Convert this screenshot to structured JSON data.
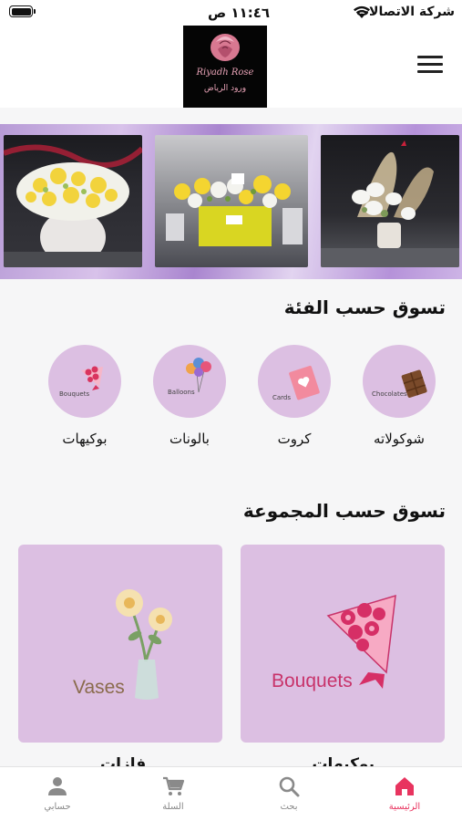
{
  "status_bar": {
    "time": "١١:٤٦ ص",
    "carrier": "شركة الاتصالات"
  },
  "header": {
    "logo_name": "Riyadh Rose",
    "logo_arabic": "ورود الرياض"
  },
  "banner": {
    "photos": [
      "yellow-white-bouquet",
      "yellow-roses-box",
      "white-orchids-vase"
    ]
  },
  "categories": {
    "title": "تسوق حسب الفئة",
    "items": [
      {
        "label": "شوكولاته",
        "icon_label": "Chocolates",
        "icon": "chocolate-icon"
      },
      {
        "label": "كروت",
        "icon_label": "Cards",
        "icon": "card-icon"
      },
      {
        "label": "بالونات",
        "icon_label": "Balloons",
        "icon": "balloons-icon"
      },
      {
        "label": "بوكيهات",
        "icon_label": "Bouquets",
        "icon": "bouquet-icon"
      }
    ]
  },
  "collections": {
    "title": "تسوق حسب المجموعة",
    "items": [
      {
        "label": "بوكيهات",
        "card_text": "Bouquets",
        "icon": "bouquet-icon"
      },
      {
        "label": "فازات",
        "card_text": "Vases",
        "icon": "vase-icon"
      }
    ]
  },
  "bottom_nav": {
    "items": [
      {
        "label": "الرئيسية",
        "icon": "home-icon",
        "active": true
      },
      {
        "label": "بحث",
        "icon": "search-icon",
        "active": false
      },
      {
        "label": "السلة",
        "icon": "cart-icon",
        "active": false
      },
      {
        "label": "حسابي",
        "icon": "person-icon",
        "active": false
      }
    ]
  },
  "colors": {
    "accent": "#e8345f",
    "card_bg": "#dcbfe2",
    "bouquets_text": "#c8336a",
    "vases_text": "#8a6b4c"
  }
}
